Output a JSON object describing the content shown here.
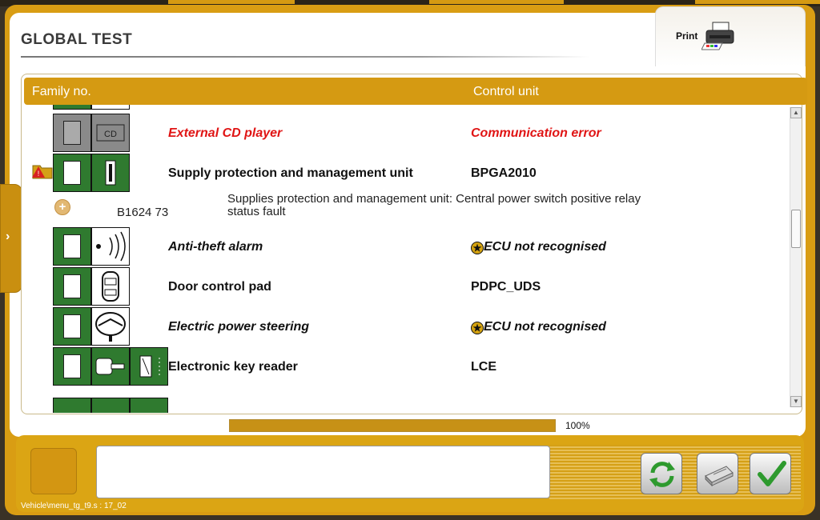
{
  "header": {
    "title": "GLOBAL TEST",
    "print_label": "Print"
  },
  "table": {
    "columns": [
      "Family no.",
      "Control unit"
    ],
    "rows": [
      {
        "family": "External CD player",
        "control": "Communication error",
        "style": "error",
        "icon": "cd-player-icon"
      },
      {
        "family": "Supply protection and management unit",
        "control": "BPGA2010",
        "style": "ok",
        "icon": "supply-unit-icon"
      },
      {
        "family": "Anti-theft alarm",
        "control": "ECU not recognised",
        "style": "unrecognised",
        "icon": "alarm-icon"
      },
      {
        "family": "Door control pad",
        "control": "PDPC_UDS",
        "style": "ok",
        "icon": "car-door-icon"
      },
      {
        "family": "Electric power steering",
        "control": "ECU not recognised",
        "style": "unrecognised",
        "icon": "steering-wheel-icon"
      },
      {
        "family": "Electronic key reader",
        "control": "LCE",
        "style": "ok",
        "icon": "key-reader-icon"
      }
    ],
    "fault": {
      "code": "B1624 73",
      "description": "Supplies protection and management unit: Central power switch positive relay status fault"
    }
  },
  "progress": {
    "value": 1.0,
    "label": "100%"
  },
  "footer": {
    "status": "Vehicle\\menu_tg_t9.s : 17_02",
    "buttons": [
      "refresh-icon",
      "print-report-icon",
      "validate-check-icon"
    ]
  },
  "colors": {
    "accent": "#d59a12",
    "ecu_green": "#2f7a2f",
    "error_red": "#e01515"
  }
}
